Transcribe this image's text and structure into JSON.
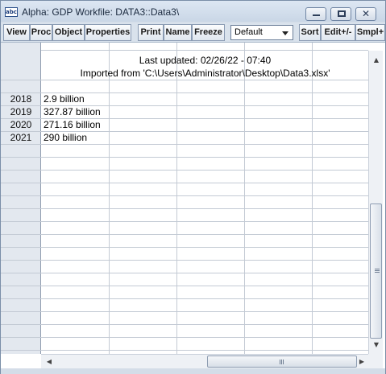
{
  "window": {
    "icon_text": "abc",
    "title": "Alpha: GDP   Workfile: DATA3::Data3\\"
  },
  "toolbar": {
    "buttons": [
      "View",
      "Proc",
      "Object",
      "Properties",
      "Print",
      "Name",
      "Freeze",
      "Sort",
      "Edit+/-",
      "Smpl+"
    ],
    "display_select": "Default"
  },
  "sheet": {
    "header_lines": [
      "Last updated: 02/26/22 - 07:40",
      "Imported from 'C:\\Users\\Administrator\\Desktop\\Data3.xlsx'"
    ],
    "rows": [
      {
        "label": "2018",
        "value": "2.9 billion"
      },
      {
        "label": "2019",
        "value": "327.87 billion"
      },
      {
        "label": "2020",
        "value": "271.16 billion"
      },
      {
        "label": "2021",
        "value": "290 billion"
      }
    ]
  },
  "icons": {
    "app": "alpha-series-icon",
    "minimize": "minimize-icon",
    "maximize": "maximize-icon",
    "close": "close-icon",
    "dropdown": "chevron-down-icon",
    "scroll_up": "scroll-up-icon",
    "scroll_down": "scroll-down-icon",
    "scroll_left": "scroll-left-icon",
    "scroll_right": "scroll-right-icon"
  },
  "colors": {
    "frame": "#d4dde8",
    "row_header": "#e3e8ef",
    "grid_line": "#c3cad4"
  }
}
